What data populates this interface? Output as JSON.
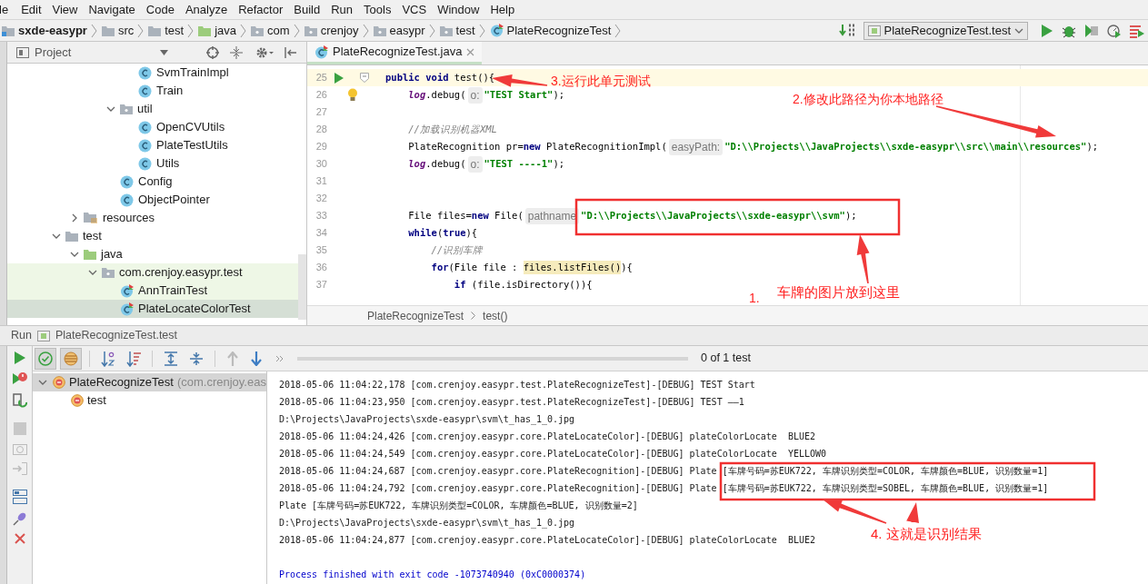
{
  "menu": [
    "le",
    "Edit",
    "View",
    "Navigate",
    "Code",
    "Analyze",
    "Refactor",
    "Build",
    "Run",
    "Tools",
    "VCS",
    "Window",
    "Help"
  ],
  "breadcrumb": [
    {
      "label": "sxde-easypr",
      "kind": "project"
    },
    {
      "label": "src",
      "kind": "folder"
    },
    {
      "label": "test",
      "kind": "folder"
    },
    {
      "label": "java",
      "kind": "source"
    },
    {
      "label": "com",
      "kind": "package"
    },
    {
      "label": "crenjoy",
      "kind": "package"
    },
    {
      "label": "easypr",
      "kind": "package"
    },
    {
      "label": "test",
      "kind": "package"
    },
    {
      "label": "PlateRecognizeTest",
      "kind": "test-class"
    }
  ],
  "run_config": "PlateRecognizeTest.test",
  "project_panel": {
    "title": "Project",
    "tree": [
      {
        "label": "SvmTrainImpl",
        "kind": "class",
        "selected": false
      },
      {
        "label": "Train",
        "kind": "class",
        "selected": false
      },
      {
        "label": "util",
        "kind": "package",
        "expanded": true,
        "selected": false,
        "children": [
          {
            "label": "OpenCVUtils",
            "kind": "class",
            "selected": false
          },
          {
            "label": "PlateTestUtils",
            "kind": "class",
            "selected": false
          },
          {
            "label": "Utils",
            "kind": "class",
            "selected": false
          }
        ]
      },
      {
        "label": "Config",
        "kind": "class",
        "selected": false
      },
      {
        "label": "ObjectPointer",
        "kind": "class",
        "selected": false
      },
      {
        "label": "resources",
        "kind": "resources",
        "expanded": false,
        "selected": false
      },
      {
        "label": "test",
        "kind": "folder",
        "expanded": true,
        "selected": false,
        "children": [
          {
            "label": "java",
            "kind": "source",
            "expanded": true,
            "selected": false,
            "children": [
              {
                "label": "com.crenjoy.easypr.test",
                "kind": "package",
                "expanded": true,
                "selected": false,
                "children": [
                  {
                    "label": "AnnTrainTest",
                    "kind": "test-class",
                    "selected": false
                  },
                  {
                    "label": "PlateLocateColorTest",
                    "kind": "test-class",
                    "selected": true
                  }
                ]
              }
            ]
          }
        ]
      }
    ]
  },
  "editor": {
    "tabs": [
      {
        "label": "PlateRecognizeTest.java",
        "selected": true
      }
    ],
    "lines": [
      {
        "number": "25",
        "current": true,
        "run_marker": true,
        "tokens": [
          {
            "kind": "kw",
            "text": "public void "
          },
          {
            "kind": "plain",
            "text": "test"
          },
          {
            "kind": "plain",
            "text": "(){"
          }
        ]
      },
      {
        "number": "26",
        "current": false,
        "bulb": true,
        "tokens": [
          {
            "kind": "field",
            "text": "    log"
          },
          {
            "kind": "plain",
            "text": ".debug("
          },
          {
            "kind": "hint",
            "text": "o:"
          },
          {
            "kind": "str",
            "text": "\"TEST Start\""
          },
          {
            "kind": "plain",
            "text": ");"
          }
        ]
      },
      {
        "number": "27",
        "current": false
      },
      {
        "number": "28",
        "current": false,
        "tokens": [
          {
            "kind": "comment",
            "text": "    //加载识别机器XML"
          }
        ]
      },
      {
        "number": "29",
        "current": false,
        "tokens": [
          {
            "kind": "plain",
            "text": "    PlateRecognition pr="
          },
          {
            "kind": "kw",
            "text": "new"
          },
          {
            "kind": "plain",
            "text": " PlateRecognitionImpl("
          },
          {
            "kind": "hint",
            "text": "easyPath:"
          },
          {
            "kind": "str",
            "text": "\"D:\\\\Projects\\\\JavaProjects\\\\sxde-easypr\\\\src\\\\main\\\\resources\""
          },
          {
            "kind": "plain",
            "text": ");"
          }
        ]
      },
      {
        "number": "30",
        "current": false,
        "tokens": [
          {
            "kind": "field",
            "text": "    log"
          },
          {
            "kind": "plain",
            "text": ".debug("
          },
          {
            "kind": "hint",
            "text": "o:"
          },
          {
            "kind": "str",
            "text": "\"TEST ----1\""
          },
          {
            "kind": "plain",
            "text": ");"
          }
        ]
      },
      {
        "number": "31",
        "current": false
      },
      {
        "number": "32",
        "current": false
      },
      {
        "number": "33",
        "current": false,
        "tokens": [
          {
            "kind": "plain",
            "text": "    File files="
          },
          {
            "kind": "kw",
            "text": "new"
          },
          {
            "kind": "plain",
            "text": " File("
          },
          {
            "kind": "hint",
            "text": "pathname"
          },
          {
            "kind": "str",
            "text": "\"D:\\\\Projects\\\\JavaProjects\\\\sxde-easypr\\\\svm\""
          },
          {
            "kind": "plain",
            "text": ");"
          }
        ]
      },
      {
        "number": "34",
        "current": false,
        "tokens": [
          {
            "kind": "kw",
            "text": "    while"
          },
          {
            "kind": "plain",
            "text": "("
          },
          {
            "kind": "kw",
            "text": "true"
          },
          {
            "kind": "plain",
            "text": "){"
          }
        ]
      },
      {
        "number": "35",
        "current": false,
        "tokens": [
          {
            "kind": "comment",
            "text": "        //识别车牌"
          }
        ]
      },
      {
        "number": "36",
        "current": false,
        "tokens": [
          {
            "kind": "kw",
            "text": "        for"
          },
          {
            "kind": "plain",
            "text": "(File file : "
          },
          {
            "kind": "mark",
            "text": "files.listFiles()"
          },
          {
            "kind": "plain",
            "text": "){"
          }
        ]
      },
      {
        "number": "37",
        "current": false,
        "tokens": [
          {
            "kind": "kw",
            "text": "            if"
          },
          {
            "kind": "plain",
            "text": " (file.isDirectory()){"
          }
        ]
      }
    ],
    "breadcrumb": [
      "PlateRecognizeTest",
      "test()"
    ]
  },
  "run_panel": {
    "label": "Run",
    "config": "PlateRecognizeTest.test",
    "status": "0 of 1 test",
    "toggles": [
      {
        "kind": "passed",
        "on": true
      },
      {
        "kind": "ignored",
        "on": true
      }
    ],
    "tree": [
      {
        "label": "PlateRecognizeTest",
        "detail": "(com.crenjoy.eas",
        "selected": true,
        "expanded": true,
        "children": [
          {
            "label": "test",
            "selected": false
          }
        ]
      }
    ],
    "console": [
      {
        "kind": "log",
        "text": "2018-05-06 11:04:22,178 [com.crenjoy.easypr.test.PlateRecognizeTest]-[DEBUG] TEST Start"
      },
      {
        "kind": "log",
        "text": "2018-05-06 11:04:23,950 [com.crenjoy.easypr.test.PlateRecognizeTest]-[DEBUG] TEST ——1"
      },
      {
        "kind": "log",
        "text": "D:\\Projects\\JavaProjects\\sxde-easypr\\svm\\t_has_1_0.jpg"
      },
      {
        "kind": "log",
        "text": "2018-05-06 11:04:24,426 [com.crenjoy.easypr.core.PlateLocateColor]-[DEBUG] plateColorLocate  BLUE2"
      },
      {
        "kind": "log",
        "text": "2018-05-06 11:04:24,549 [com.crenjoy.easypr.core.PlateLocateColor]-[DEBUG] plateColorLocate  YELLOW0"
      },
      {
        "kind": "log",
        "text": "2018-05-06 11:04:24,687 [com.crenjoy.easypr.core.PlateRecognition]-[DEBUG] Plate ",
        "result": "[车牌号码=苏EUK722, 车牌识别类型=COLOR, 车牌颜色=BLUE, 识别数量=1]"
      },
      {
        "kind": "log",
        "text": "2018-05-06 11:04:24,792 [com.crenjoy.easypr.core.PlateRecognition]-[DEBUG] Plate ",
        "result": "[车牌号码=苏EUK722, 车牌识别类型=SOBEL, 车牌颜色=BLUE, 识别数量=1]"
      },
      {
        "kind": "log",
        "text": "Plate [车牌号码=苏EUK722, 车牌识别类型=COLOR, 车牌颜色=BLUE, 识别数量=2]"
      },
      {
        "kind": "log",
        "text": "D:\\Projects\\JavaProjects\\sxde-easypr\\svm\\t_has_1_0.jpg"
      },
      {
        "kind": "log",
        "text": "2018-05-06 11:04:24,877 [com.crenjoy.easypr.core.PlateLocateColor]-[DEBUG] plateColorLocate  BLUE2"
      },
      {
        "kind": "exit",
        "text": "Process finished with exit code -1073740940 (0xC0000374)"
      }
    ]
  },
  "annotations": [
    "3.运行此单元测试",
    "2.修改此路径为你本地路径",
    "1.",
    "车牌的图片放到这里",
    "4.  这就是识别结果"
  ]
}
